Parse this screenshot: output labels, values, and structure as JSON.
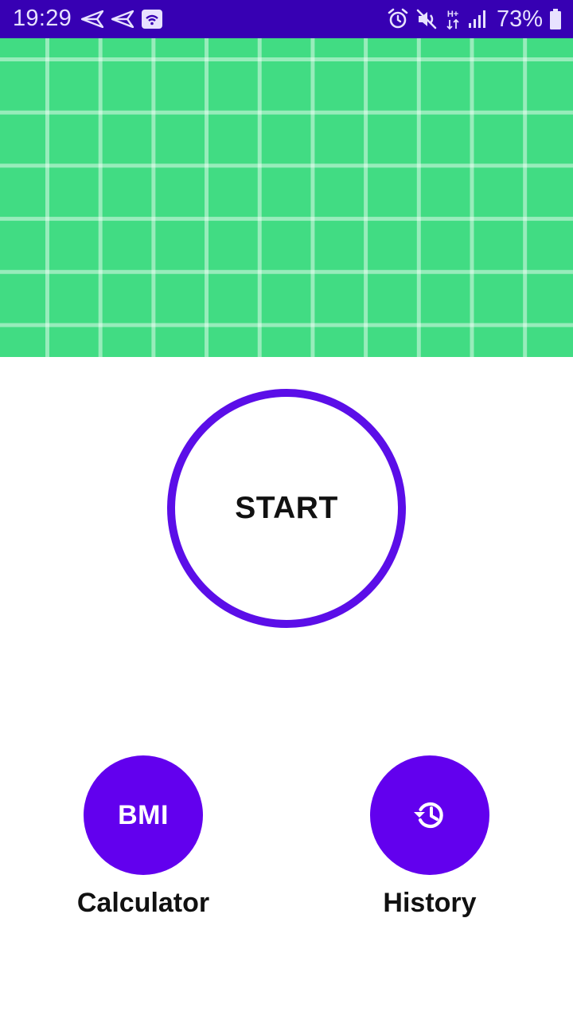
{
  "status_bar": {
    "time": "19:29",
    "battery": "73%",
    "network_type": "H+",
    "icons": [
      "send-icon",
      "send-icon",
      "wifi-icon",
      "alarm-icon",
      "mute-icon",
      "network-icon",
      "signal-icon",
      "battery-icon"
    ]
  },
  "header": {
    "background": "#41dc83",
    "pattern": "grid"
  },
  "start": {
    "label": "START",
    "ring_color": "#5b0ee8"
  },
  "actions": {
    "bmi": {
      "button_text": "BMI",
      "label": "Calculator"
    },
    "history": {
      "icon": "history-icon",
      "label": "History"
    },
    "button_color": "#6200ee"
  }
}
